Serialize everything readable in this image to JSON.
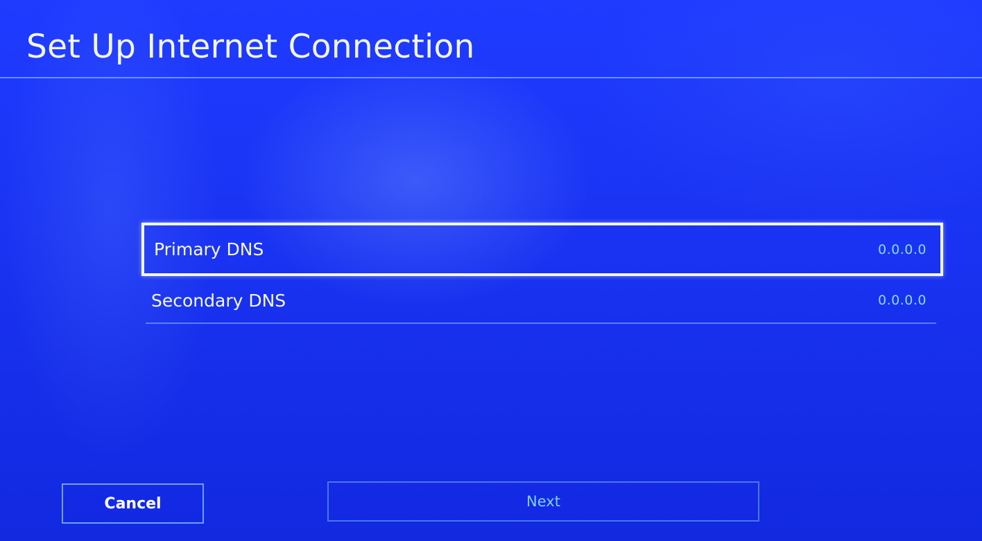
{
  "header": {
    "title": "Set Up Internet Connection"
  },
  "dns": {
    "items": [
      {
        "label": "Primary DNS",
        "value": "0.0.0.0",
        "selected": true
      },
      {
        "label": "Secondary DNS",
        "value": "0.0.0.0",
        "selected": false
      }
    ]
  },
  "footer": {
    "cancel_label": "Cancel",
    "next_label": "Next"
  },
  "colors": {
    "background": "#1a33f2",
    "value_text": "#8ed8ff",
    "focus_border": "#f4f6ff"
  }
}
